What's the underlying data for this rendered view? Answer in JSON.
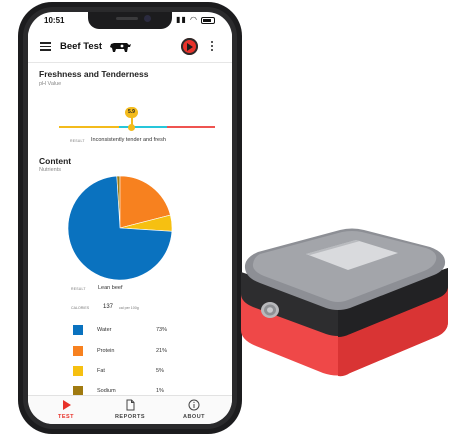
{
  "status_bar": {
    "time": "10:51",
    "icons": "▮▮ ◠"
  },
  "app_bar": {
    "title": "Beef Test"
  },
  "freshness": {
    "title": "Freshness and Tenderness",
    "subtitle": "pH Value",
    "ph_value": "5.9",
    "result_label": "RESULT",
    "result_value": "Inconsistently tender and fresh",
    "colors": [
      "#f3bb1c",
      "#26c6da",
      "#ef5350"
    ]
  },
  "content": {
    "title": "Content",
    "subtitle": "Nutrients",
    "result_label": "RESULT",
    "result_value": "Lean beef",
    "calories_label": "CALORIES",
    "calories_value": "137",
    "calories_unit": "cal per 100g"
  },
  "nutrients": [
    {
      "label": "Water",
      "pct": "73%",
      "color": "#0a72bf"
    },
    {
      "label": "Protein",
      "pct": "21%",
      "color": "#f7811f"
    },
    {
      "label": "Fat",
      "pct": "5%",
      "color": "#f6c011"
    },
    {
      "label": "Sodium",
      "pct": "1%",
      "color": "#a07a10"
    }
  ],
  "chart_data": {
    "type": "pie",
    "categories": [
      "Water",
      "Protein",
      "Fat",
      "Sodium"
    ],
    "values": [
      73,
      21,
      5,
      1
    ],
    "colors": [
      "#0a72bf",
      "#f7811f",
      "#f6c011",
      "#a07a10"
    ]
  },
  "bottom_nav": [
    {
      "label": "TEST",
      "icon": "play-icon"
    },
    {
      "label": "REPORTS",
      "icon": "document-icon"
    },
    {
      "label": "ABOUT",
      "icon": "info-icon"
    }
  ]
}
